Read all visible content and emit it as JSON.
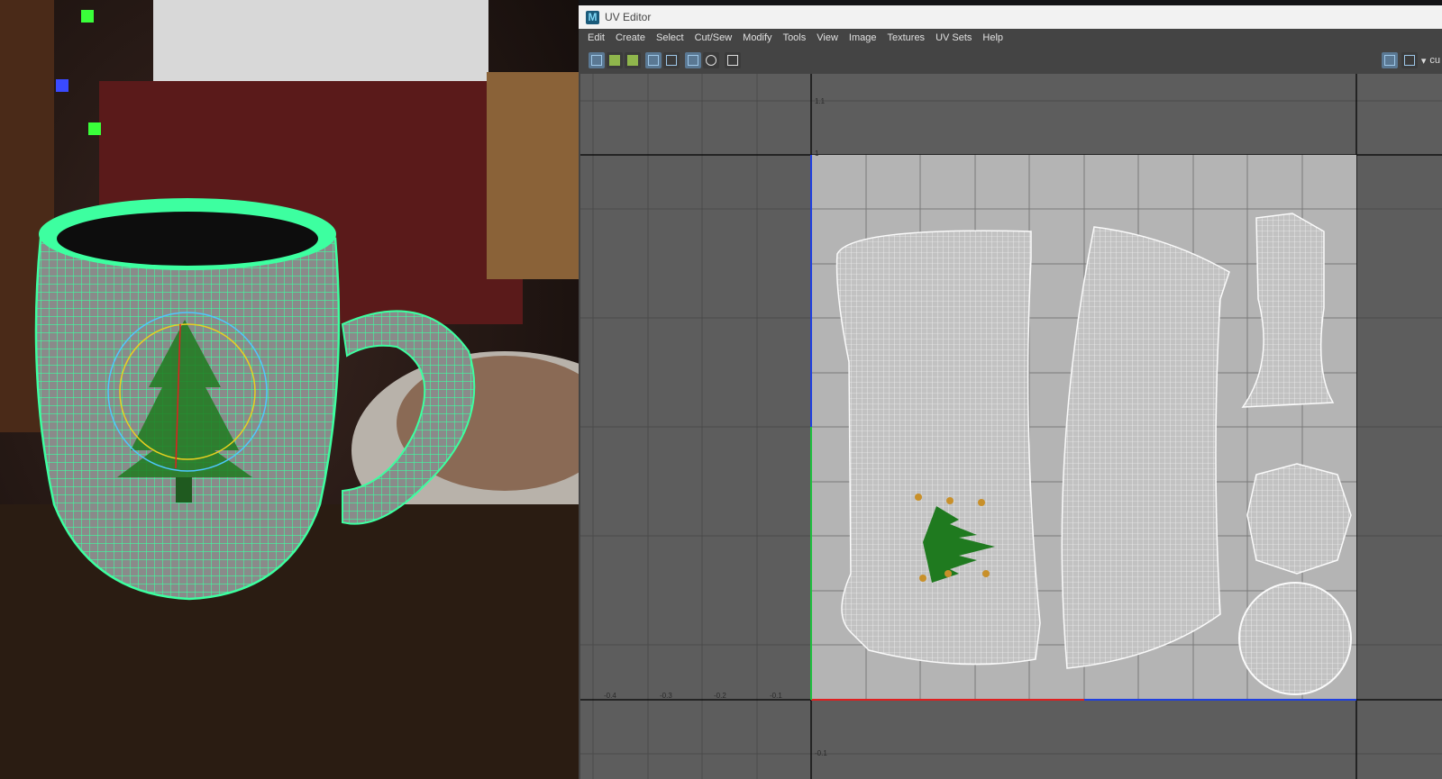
{
  "window": {
    "title": "UV Editor",
    "app_icon_letter": "M"
  },
  "menus": [
    "Edit",
    "Create",
    "Select",
    "Cut/Sew",
    "Modify",
    "Tools",
    "View",
    "Image",
    "Textures",
    "UV Sets",
    "Help"
  ],
  "toolbar": {
    "right_label": "cu",
    "icons": [
      "uv-snapshot-icon",
      "shell-select-icon",
      "border-icon",
      "grid-toggle-icon",
      "checker-icon",
      "pixel-snap-icon",
      "dim-image-icon",
      "camera-icon"
    ]
  },
  "axis": {
    "x_ticks": [
      "-0.4",
      "-0.3",
      "-0.2",
      "-0.1"
    ],
    "y_top_labels": [
      "1.1",
      "1"
    ],
    "y_bottom_labels": [
      "-0.1"
    ]
  },
  "colors": {
    "wireframe": "#3dffa0",
    "uv_tile": "#b4b4b4",
    "grid_bg": "#5d5d5d",
    "axis_u": "#e02020",
    "axis_v": "#2040e0",
    "tree": "#1f7a1f"
  },
  "viewport": {
    "subject": "mug-with-wireframe"
  }
}
